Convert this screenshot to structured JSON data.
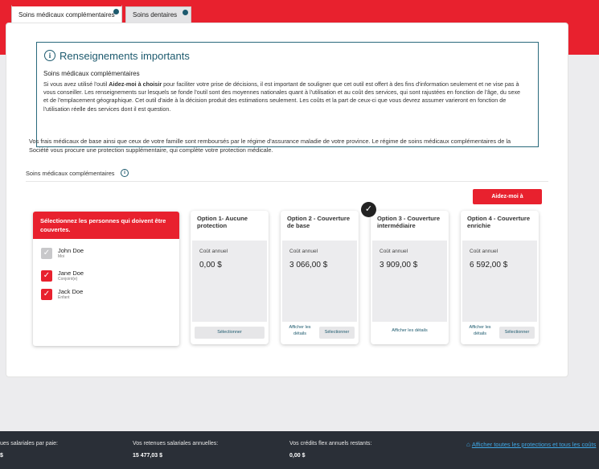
{
  "tabs": [
    {
      "label": "Soins médicaux complémentaires"
    },
    {
      "label": "Soins dentaires"
    }
  ],
  "info": {
    "title": "Renseignements importants",
    "subtitle": "Soins médicaux complémentaires",
    "body_before": "Si vous avez utilisé l'outil ",
    "body_bold": "Aidez-moi à choisir",
    "body_after": " pour faciliter votre prise de décisions, il est important de souligner que cet outil est offert à des fins d'information seulement et ne vise pas à vous conseiller. Les renseignements sur lesquels se fonde l'outil sont des moyennes nationales quant à l'utilisation et au coût des services, qui sont rajustées en fonction de l'âge, du sexe et de l'emplacement géographique. Cet outil d'aide à la décision produit des estimations seulement. Les coûts et la part de ceux-ci que vous devrez assumer varieront en fonction de l'utilisation réelle des services dont il est question."
  },
  "paragraph": "Vos frais médicaux de base ainsi que ceux de votre famille sont remboursés par le régime d'assurance maladie de votre province. Le régime de soins médicaux complémentaires de la Société vous procure une protection supplémentaire, qui complète votre protection médicale.",
  "section_label": "Soins médicaux complémentaires",
  "aide_button": "Aidez-moi à",
  "persons": {
    "header": "Sélectionnez les personnes qui doivent être couvertes.",
    "list": [
      {
        "name": "John Doe",
        "role": "Moi",
        "checked": true,
        "disabled": true
      },
      {
        "name": "Jane Doe",
        "role": "Conjoint(e)",
        "checked": true,
        "disabled": false
      },
      {
        "name": "Jack Doe",
        "role": "Enfant",
        "checked": true,
        "disabled": false
      }
    ]
  },
  "options": [
    {
      "title": "Option 1- Aucune protection",
      "cost_label": "Coût annuel",
      "cost": "0,00 $",
      "details": "",
      "select": "Sélectionner",
      "selected": false
    },
    {
      "title": "Option 2 - Couverture de base",
      "cost_label": "Coût annuel",
      "cost": "3 066,00 $",
      "details": "Afficher les détails",
      "select": "Sélectionner",
      "selected": false
    },
    {
      "title": "Option 3 - Couverture intermédiaire",
      "cost_label": "Coût annuel",
      "cost": "3 909,00 $",
      "details": "Afficher les détails",
      "select": "",
      "selected": true
    },
    {
      "title": "Option 4 - Couverture enrichie",
      "cost_label": "Coût annuel",
      "cost": "6 592,00 $",
      "details": "Afficher les détails",
      "select": "Sélectionner",
      "selected": false
    }
  ],
  "footer": {
    "per_pay_label": "ues salariales par paie:",
    "per_pay_value": "$",
    "annual_label": "Vos retenues salariales annuelles:",
    "annual_value": "15 477,03 $",
    "credits_label": "Vos crédits flex annuels restants:",
    "credits_value": "0,00 $",
    "link": "Afficher toutes les protections et tous les coûts",
    "link_icon": "tag-icon"
  },
  "colors": {
    "brand_red": "#e8212e",
    "teal": "#1d5a6e",
    "footer_bg": "#2a2f37",
    "link_blue": "#3fa8e6"
  }
}
